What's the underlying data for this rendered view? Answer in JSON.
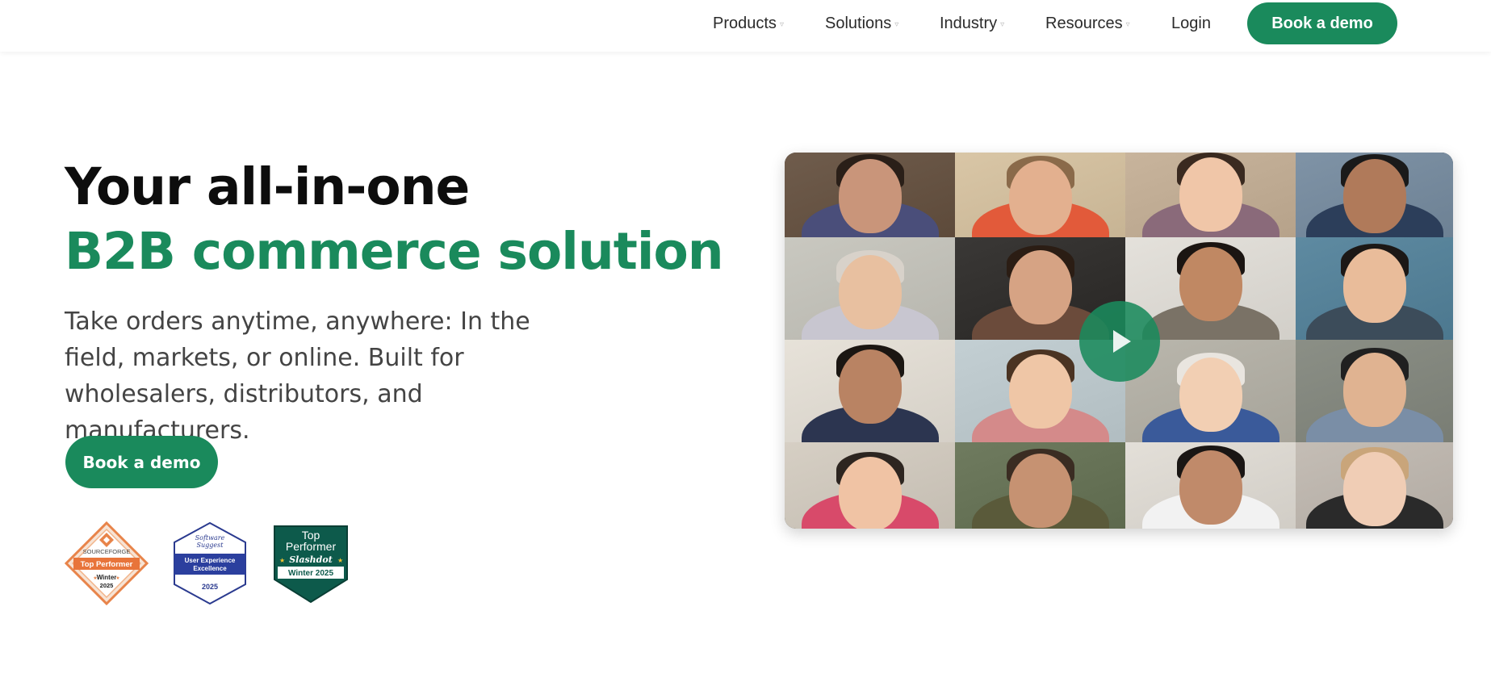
{
  "header": {
    "nav": [
      {
        "label": "Products",
        "has_dropdown": true
      },
      {
        "label": "Solutions",
        "has_dropdown": true
      },
      {
        "label": "Industry",
        "has_dropdown": true
      },
      {
        "label": "Resources",
        "has_dropdown": true
      }
    ],
    "login_label": "Login",
    "cta_label": "Book a demo"
  },
  "hero": {
    "title_line1": "Your all-in-one",
    "title_line2": "B2B commerce solution",
    "subtitle": "Take orders anytime, anywhere: In the field, markets, or online. Built for wholesalers, distributors, and manufacturers.",
    "cta_label": "Book a demo"
  },
  "badges": [
    {
      "name": "SourceForge",
      "lines": [
        "SOURCEFORGE",
        "Top Performer",
        "Winter",
        "2025"
      ]
    },
    {
      "name": "Software Suggest",
      "lines": [
        "Software",
        "Suggest",
        "User Experience",
        "Excellence",
        "2025"
      ]
    },
    {
      "name": "Slashdot",
      "lines": [
        "Top",
        "Performer",
        "Slashdot",
        "Winter 2025"
      ]
    }
  ],
  "video": {
    "play_icon": "play-icon",
    "tile_colors": [
      "#6f5c4c",
      "#d9c6a6",
      "#c8b49c",
      "#7f93a6",
      "#c9c8c0",
      "#3a3836",
      "#e4e1db",
      "#5e8aa1",
      "#e7e2d9",
      "#c3cfd3",
      "#b9b6ac",
      "#8b8f86",
      "#d6cfc4",
      "#6f7b5f",
      "#e3dfd8",
      "#c4bdb5"
    ]
  },
  "colors": {
    "brand_green": "#1a8a5c",
    "heading_dark": "#0d0d0d",
    "body_text": "#444444"
  }
}
